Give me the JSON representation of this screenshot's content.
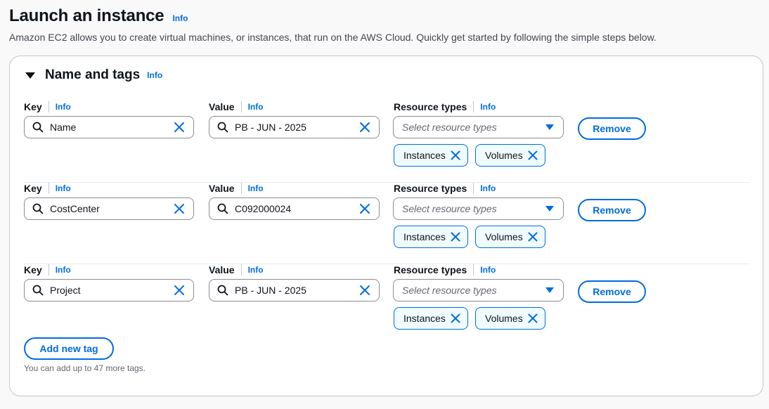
{
  "page": {
    "title": "Launch an instance",
    "title_info": "Info",
    "subtitle": "Amazon EC2 allows you to create virtual machines, or instances, that run on the AWS Cloud. Quickly get started by following the simple steps below."
  },
  "section": {
    "title": "Name and tags",
    "info": "Info"
  },
  "labels": {
    "key": "Key",
    "value": "Value",
    "resource_types": "Resource types",
    "info": "Info",
    "resource_placeholder": "Select resource types",
    "remove": "Remove"
  },
  "tags": [
    {
      "key": "Name",
      "value": "PB - JUN - 2025",
      "tokens": [
        "Instances",
        "Volumes"
      ]
    },
    {
      "key": "CostCenter",
      "value": "C092000024",
      "tokens": [
        "Instances",
        "Volumes"
      ]
    },
    {
      "key": "Project",
      "value": "PB - JUN - 2025",
      "tokens": [
        "Instances",
        "Volumes"
      ]
    }
  ],
  "add_tag_label": "Add new tag",
  "hint": "You can add up to 47 more tags.",
  "colors": {
    "accent": "#006ce0",
    "text": "#0f141a",
    "border": "#8c8c94"
  }
}
